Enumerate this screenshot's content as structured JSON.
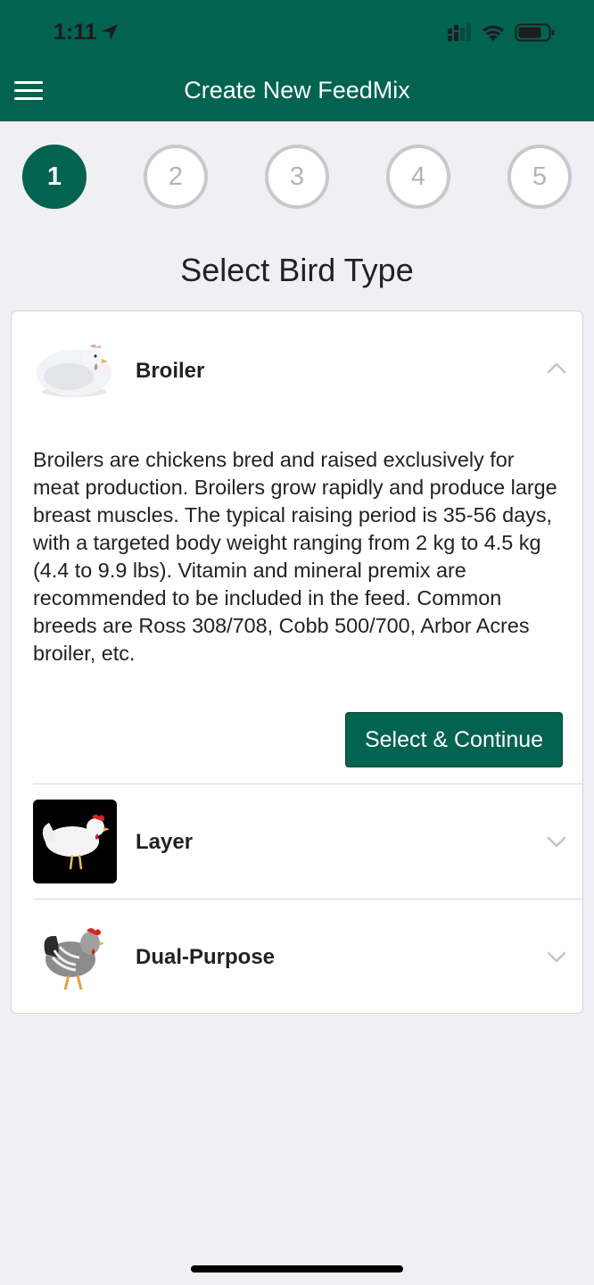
{
  "status_bar": {
    "time": "1:11"
  },
  "header": {
    "title": "Create New FeedMix"
  },
  "steps": [
    "1",
    "2",
    "3",
    "4",
    "5"
  ],
  "active_step": 1,
  "section": {
    "title": "Select Bird Type"
  },
  "bird_types": [
    {
      "label": "Broiler",
      "expanded": true,
      "description": "Broilers are chickens bred and raised exclusively for meat production. Broilers grow rapidly and produce large breast muscles. The typical raising period is 35-56 days, with a targeted body weight ranging from 2 kg to 4.5 kg (4.4 to 9.9 lbs). Vitamin and mineral premix are recommended to be included in the feed. Common breeds are Ross 308/708, Cobb 500/700, Arbor Acres broiler, etc.",
      "action_label": "Select & Continue"
    },
    {
      "label": "Layer",
      "expanded": false
    },
    {
      "label": "Dual-Purpose",
      "expanded": false
    }
  ],
  "colors": {
    "brand": "#02634f",
    "background": "#efeff4"
  }
}
